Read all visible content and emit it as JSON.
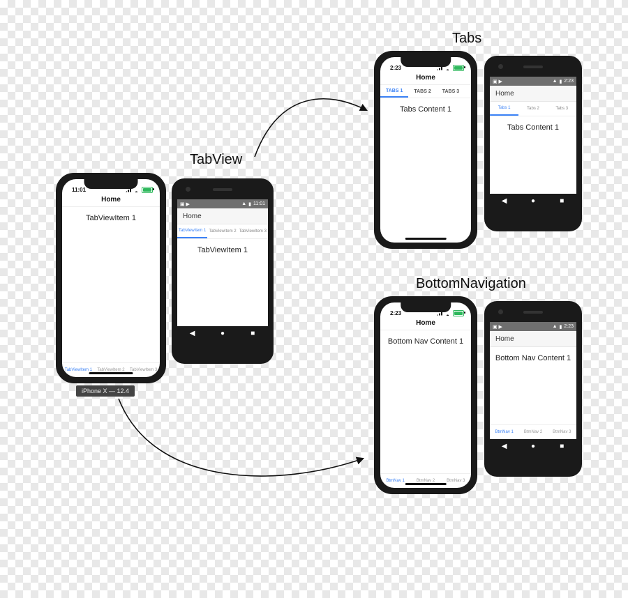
{
  "labels": {
    "tabview": "TabView",
    "tabs": "Tabs",
    "bottomnav": "BottomNavigation",
    "device_iphone": "iPhone X — 12.4"
  },
  "common": {
    "home": "Home",
    "time_tv": "11:01",
    "time_tabs": "2:23",
    "time_and": "2:23"
  },
  "tabview": {
    "content": "TabViewItem 1",
    "items": [
      "TabViewItem 1",
      "TabViewItem 2",
      "TabViewItem 3"
    ]
  },
  "tabs": {
    "content": "Tabs Content 1",
    "ios_items": [
      "TABS 1",
      "TABS 2",
      "TABS 3"
    ],
    "and_items": [
      "Tabs 1",
      "Tabs 2",
      "Tabs 3"
    ]
  },
  "bottomnav": {
    "content": "Bottom Nav Content 1",
    "items": [
      "BtmNav 1",
      "BtmNav 2",
      "BtmNav 3"
    ]
  },
  "android_nav": {
    "back": "◀",
    "home": "●",
    "recent": "■"
  },
  "android_status_left": "▣ ▶"
}
